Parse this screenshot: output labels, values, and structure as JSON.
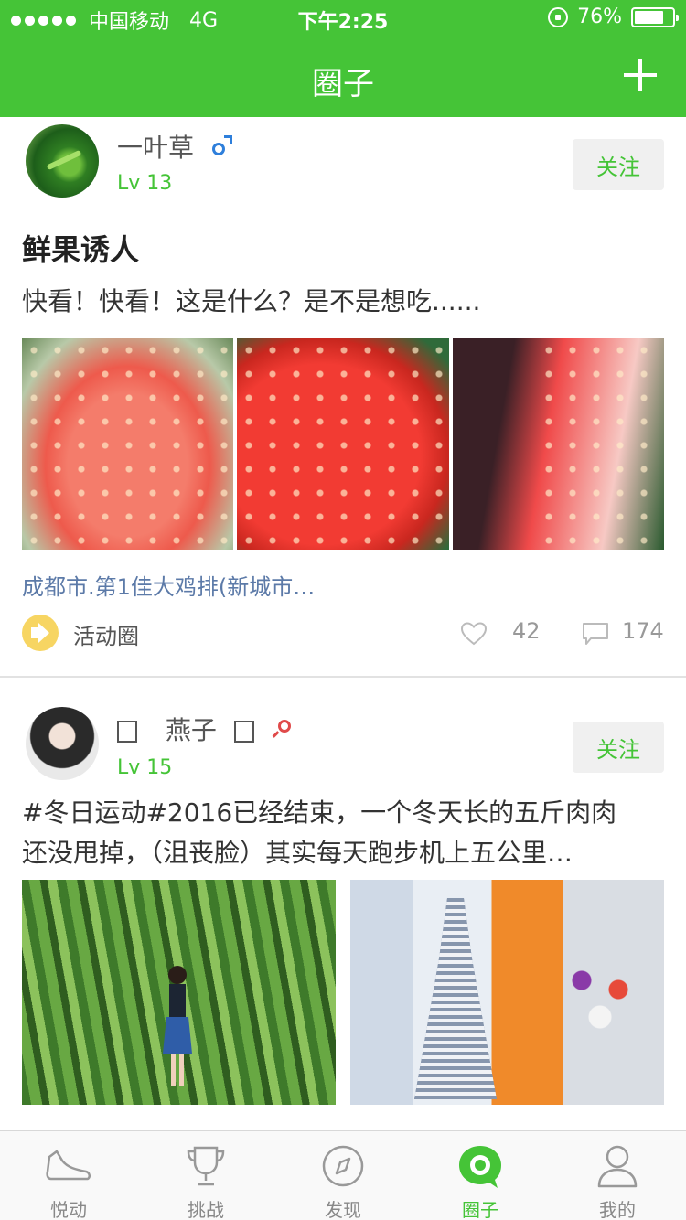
{
  "status_bar": {
    "carrier": "中国移动",
    "network": "4G",
    "time": "下午2:25",
    "battery_percent": "76%",
    "battery_level": 0.76
  },
  "nav": {
    "title": "圈子",
    "add_icon": "plus-icon"
  },
  "colors": {
    "brand": "#45c437",
    "link": "#5c7aa8",
    "male": "#2e7fdb",
    "female": "#e04a4a"
  },
  "posts": [
    {
      "username": "一叶草",
      "gender_icon": "male-icon",
      "level": "Lv 13",
      "follow_label": "关注",
      "title": "鲜果诱人",
      "text": "快看！快看！这是什么？是不是想吃......",
      "location": "成都市.第1佳大鸡排(新城市…",
      "circle_name": "活动圈",
      "likes": "42",
      "comments": "174"
    },
    {
      "username": "燕子",
      "gender_icon": "female-icon",
      "level": "Lv 15",
      "follow_label": "关注",
      "text_line1": "#冬日运动#2016已经结束，一个冬天长的五斤肉肉",
      "text_line2": "还没甩掉，（沮丧脸）其实每天跑步机上五公里…"
    }
  ],
  "tabbar": {
    "items": [
      {
        "label": "悦动",
        "icon": "sneaker-icon"
      },
      {
        "label": "挑战",
        "icon": "trophy-icon"
      },
      {
        "label": "发现",
        "icon": "compass-icon"
      },
      {
        "label": "圈子",
        "icon": "circle-chat-icon"
      },
      {
        "label": "我的",
        "icon": "person-icon"
      }
    ],
    "active": "圈子"
  }
}
